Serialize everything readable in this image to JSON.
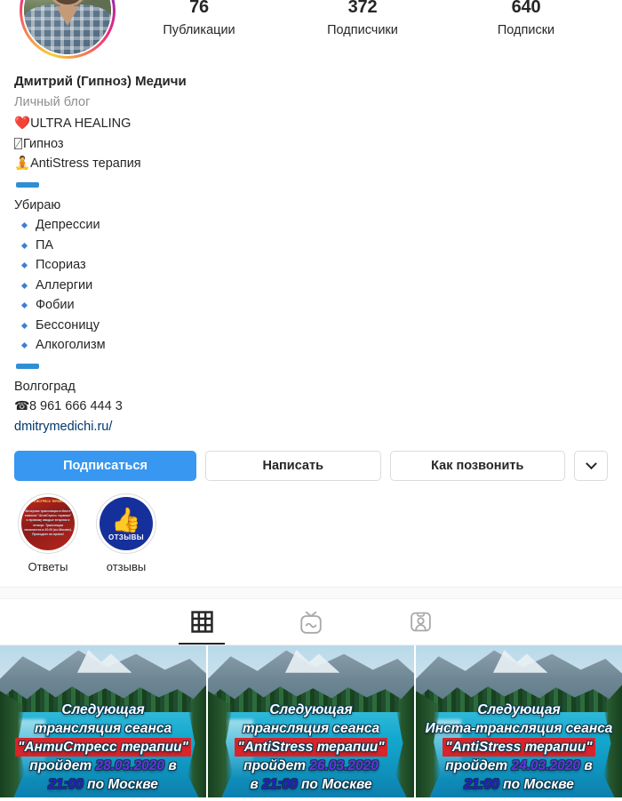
{
  "profile": {
    "avatar_alt": "profile-photo",
    "has_story_ring": true,
    "full_name": "Дмитрий (Гипноз) Медичи",
    "category": "Личный блог"
  },
  "stats": [
    {
      "value": "76",
      "label": "Публикации"
    },
    {
      "value": "372",
      "label": "Подписчики"
    },
    {
      "value": "640",
      "label": "Подписки"
    }
  ],
  "bio": {
    "line_healing": "ULTRA HEALING",
    "healing_emoji": "❤️",
    "line_hypnosis": "Гипноз",
    "line_antistress": "AntiStress терапия",
    "antistress_emoji": "🧘",
    "heading_removes": "Убираю",
    "items": [
      "Депрессии",
      "ПА",
      "Псориаз",
      "Аллергии",
      "Фобии",
      "Бессоницу",
      "Алкоголизм"
    ],
    "city": "Волгоград",
    "phone_icon": "☎",
    "phone": "8 961 666 444 3",
    "link": "dmitrymedichi.ru/"
  },
  "actions": {
    "follow": "Подписаться",
    "message": "Написать",
    "call": "Как позвонить",
    "more_icon": "chevron-down-icon"
  },
  "highlights": [
    {
      "label": "Ответы",
      "cover_title": "АНТИСТРЕСС ТЕРАПИЯ",
      "cover_text": "Вечерние трансляции в Инсте сеансов \"АнтиСтресс терапии\" я провожу каждые вторник и четверг. Трансляция начинается в 20:00 (по Москве). Приходите во время!"
    },
    {
      "label": "отзывы",
      "cover_icon": "thumbs-up-icon",
      "cover_text": "ОТЗЫВЫ"
    }
  ],
  "tabs": [
    {
      "icon": "grid-icon",
      "name": "posts",
      "active": true
    },
    {
      "icon": "igtv-icon",
      "name": "igtv",
      "active": false
    },
    {
      "icon": "tagged-icon",
      "name": "tagged",
      "active": false
    }
  ],
  "posts": [
    {
      "line1": "Следующая",
      "line2": "трансляция  сеанса",
      "highlight": "\"АнтиСтресс терапии\"",
      "prefix": "пройдет ",
      "date": "28.03.2020",
      "mid": " в",
      "time": "21:00",
      "suffix": " по Москве"
    },
    {
      "line1": "Следующая",
      "line2": "трансляция сеанса",
      "highlight": "\"AntiStress терапии\"",
      "prefix": "пройдет ",
      "date": "26.03.2020",
      "mid": "в ",
      "time": "21:00",
      "suffix": " по Москве"
    },
    {
      "line1": "Следующая",
      "line2": "Инста-трансляция сеанса",
      "highlight": "\"AntiStress терапии\"",
      "prefix": "пройдет ",
      "date": "24.03.2020",
      "mid": " в",
      "time": "21:00",
      "suffix": " по Москве"
    }
  ],
  "colors": {
    "accent_blue": "#3897f0",
    "divider_blue": "#2f8fd4",
    "link_blue": "#00376b",
    "bullet_blue": "#3b7fd4",
    "highlight_red": "#d8242a",
    "date_purple": "#6b2fe0",
    "time_blue": "#2c1ad0",
    "muted_gray": "#8e8e8e"
  }
}
